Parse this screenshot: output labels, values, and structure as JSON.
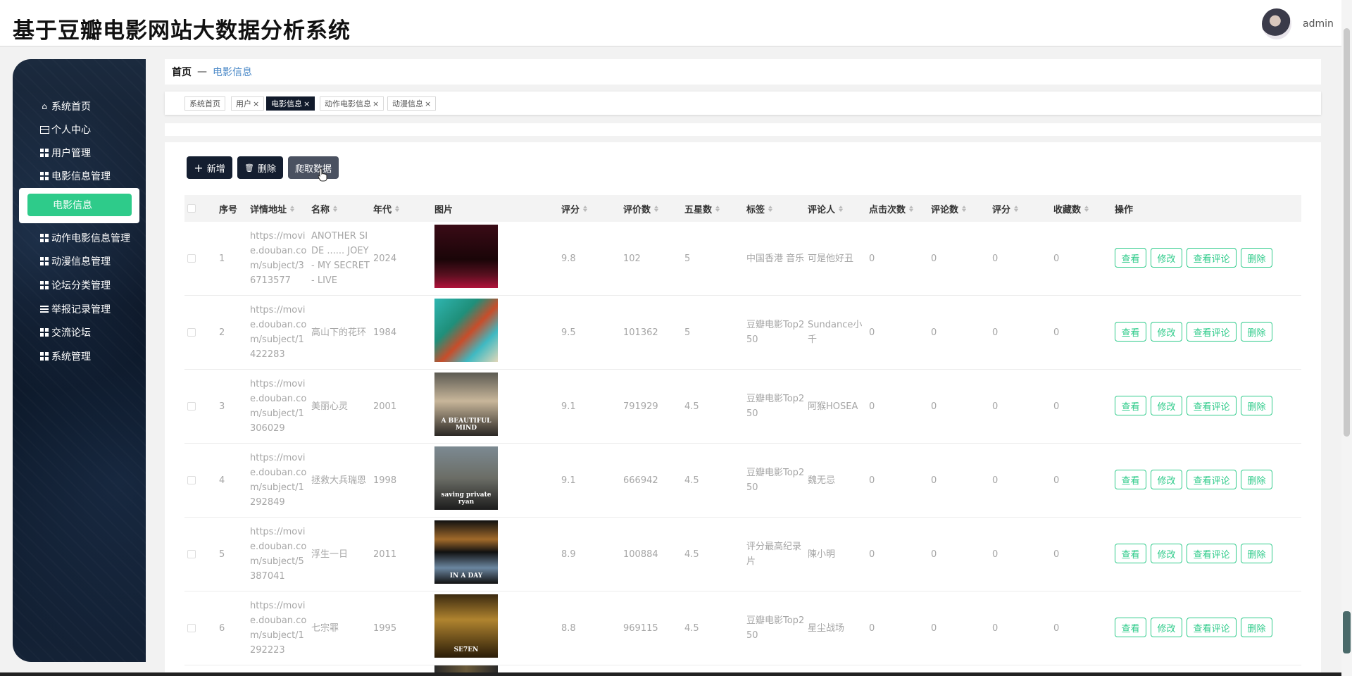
{
  "app": {
    "title": "基于豆瓣电影网站大数据分析系统",
    "username": "admin"
  },
  "sidebar": {
    "items": [
      {
        "label": "系统首页"
      },
      {
        "label": "个人中心"
      },
      {
        "label": "用户管理"
      },
      {
        "label": "电影信息管理"
      },
      {
        "label": "电影信息"
      },
      {
        "label": "动作电影信息管理"
      },
      {
        "label": "动漫信息管理"
      },
      {
        "label": "论坛分类管理"
      },
      {
        "label": "举报记录管理"
      },
      {
        "label": "交流论坛"
      },
      {
        "label": "系统管理"
      }
    ]
  },
  "breadcrumb": {
    "home": "首页",
    "sep": "—",
    "current": "电影信息"
  },
  "tabs": [
    {
      "label": "系统首页",
      "close": ""
    },
    {
      "label": "用户",
      "close": "×"
    },
    {
      "label": "电影信息",
      "close": "×"
    },
    {
      "label": "动作电影信息",
      "close": "×"
    },
    {
      "label": "动漫信息",
      "close": "×"
    }
  ],
  "toolbar": {
    "add": "新增",
    "delete": "删除",
    "crawl": "爬取数据",
    "add_icon": "+",
    "delete_icon": "🗑"
  },
  "table": {
    "columns": [
      "序号",
      "详情地址",
      "名称",
      "年代",
      "图片",
      "评分",
      "评价数",
      "五星数",
      "标签",
      "评论人",
      "点击次数",
      "评论数",
      "评分",
      "收藏数",
      "操作"
    ],
    "rows": [
      {
        "no": "1",
        "url": "https://movie.douban.com/subject/36713577",
        "name": "ANOTHER SIDE ...... JOEY - MY SECRET - LIVE",
        "year": "2024",
        "rating": "9.8",
        "votes": "102",
        "five_star": "5",
        "tag": "中国香港 音乐",
        "reviewer": "可是他好丑",
        "clicks": "0",
        "comments": "0",
        "score": "0",
        "favorites": "0"
      },
      {
        "no": "2",
        "url": "https://movie.douban.com/subject/1422283",
        "name": "高山下的花环",
        "year": "1984",
        "rating": "9.5",
        "votes": "101362",
        "five_star": "5",
        "tag": "豆瓣电影Top250",
        "reviewer": "Sundance小千",
        "clicks": "0",
        "comments": "0",
        "score": "0",
        "favorites": "0"
      },
      {
        "no": "3",
        "url": "https://movie.douban.com/subject/1306029",
        "name": "美丽心灵",
        "year": "2001",
        "rating": "9.1",
        "votes": "791929",
        "five_star": "4.5",
        "tag": "豆瓣电影Top250",
        "reviewer": "阿猴HOSEA",
        "clicks": "0",
        "comments": "0",
        "score": "0",
        "favorites": "0"
      },
      {
        "no": "4",
        "url": "https://movie.douban.com/subject/1292849",
        "name": "拯救大兵瑞恩",
        "year": "1998",
        "rating": "9.1",
        "votes": "666942",
        "five_star": "4.5",
        "tag": "豆瓣电影Top250",
        "reviewer": "魏无忌",
        "clicks": "0",
        "comments": "0",
        "score": "0",
        "favorites": "0"
      },
      {
        "no": "5",
        "url": "https://movie.douban.com/subject/5387041",
        "name": "浮生一日",
        "year": "2011",
        "rating": "8.9",
        "votes": "100884",
        "five_star": "4.5",
        "tag": "评分最高纪录片",
        "reviewer": "陳小明",
        "clicks": "0",
        "comments": "0",
        "score": "0",
        "favorites": "0"
      },
      {
        "no": "6",
        "url": "https://movie.douban.com/subject/1292223",
        "name": "七宗罪",
        "year": "1995",
        "rating": "8.8",
        "votes": "969115",
        "five_star": "4.5",
        "tag": "豆瓣电影Top250",
        "reviewer": "星尘战场",
        "clicks": "0",
        "comments": "0",
        "score": "0",
        "favorites": "0"
      }
    ],
    "posters": [
      {
        "text": "",
        "bg": "linear-gradient(180deg,#3a0b16 0%,#1a0508 55%,#5a1020 80%,#b0123a 100%)"
      },
      {
        "text": "",
        "bg": "linear-gradient(135deg,#2fb5b0 0%,#1f8f7a 35%,#c84d2a 55%,#3fb9c2 75%,#e2d7b8 100%)"
      },
      {
        "text": "A BEAUTIFUL MIND",
        "bg": "linear-gradient(180deg,#5c5a52 0%,#c8b69a 45%,#2b2824 100%)"
      },
      {
        "text": "saving private ryan",
        "bg": "linear-gradient(180deg,#7c8a92 0%,#6b6d66 50%,#1c1c1c 100%)"
      },
      {
        "text": "IN A DAY",
        "bg": "linear-gradient(180deg,#111 0%,#a16a2a 30%,#111 50%,#6b86a0 75%,#111 100%)"
      },
      {
        "text": "SE7EN",
        "bg": "linear-gradient(180deg,#3b2a10 0%,#b0842f 40%,#2a1c08 100%)"
      }
    ],
    "actions": [
      "查看",
      "修改",
      "查看评论",
      "删除"
    ]
  }
}
